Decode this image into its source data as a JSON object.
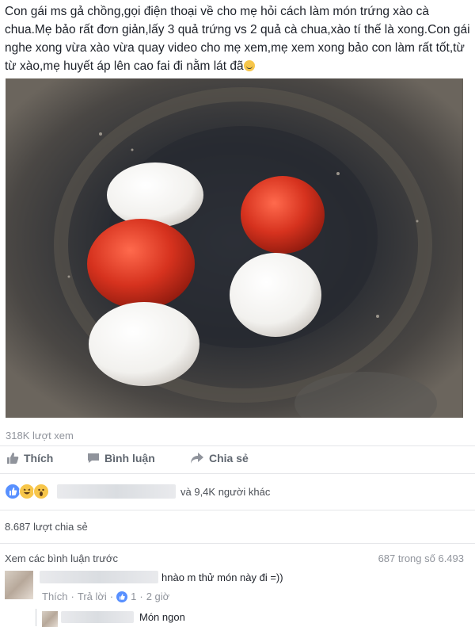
{
  "post": {
    "text": "Con gái ms gả chồng,gọi điện thoại về cho mẹ hỏi cách làm món trứng xào cà chua.Mẹ bảo rất đơn giản,lấy 3 quả trứng vs 2 quả cà chua,xào tí thế là xong.Con gái nghe xong vừa xào vừa quay video cho mẹ xem,mẹ xem xong bảo con làm rất tốt,từ từ xào,mẹ huyết áp lên cao fai đi nằm lát đã",
    "emoji_icon": "smile-emoji-icon"
  },
  "video": {
    "views": "318K lượt xem"
  },
  "actions": {
    "like": "Thích",
    "comment": "Bình luận",
    "share": "Chia sẻ"
  },
  "reactions": {
    "others_text": "và 9,4K người khác",
    "icons": [
      "like-reaction-icon",
      "haha-reaction-icon",
      "wow-reaction-icon"
    ]
  },
  "shares": {
    "text": "8.687 lượt chia sẻ"
  },
  "comments": {
    "view_previous": "Xem các bình luận trước",
    "count": "687 trong số 6.493",
    "items": [
      {
        "text": "hnào m thử món này đi =))",
        "like_label": "Thích",
        "separator1": "·",
        "reply_label": "Trả lời",
        "separator2": "·",
        "like_count": "1",
        "separator3": "·",
        "time": "2 giờ"
      }
    ],
    "reply": {
      "text": "Món ngon"
    }
  },
  "colors": {
    "link": "#365899",
    "meta": "#90949c",
    "like_blue": "#5890ff",
    "tomato": "#d6321e"
  }
}
